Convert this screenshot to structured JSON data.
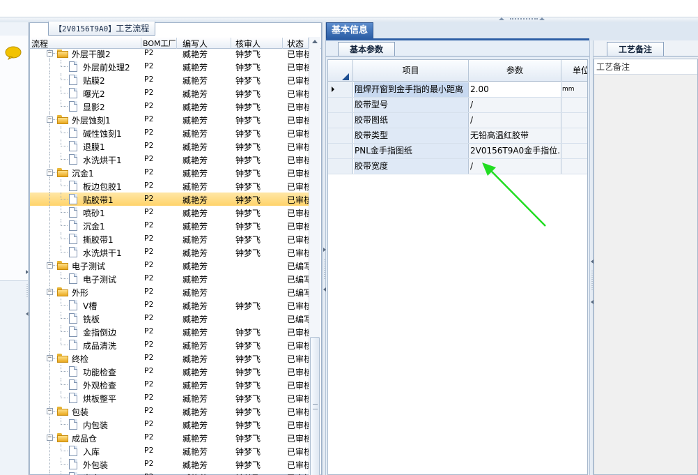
{
  "tree_panel": {
    "title_code": "【2V0156T9A0】",
    "title_text": "工艺流程",
    "columns": {
      "process": "流程",
      "bom_factory": "BOM工厂",
      "writer": "编写人",
      "reviewer": "核审人",
      "status": "状态"
    },
    "rows": [
      {
        "level": 1,
        "type": "folder",
        "name": "外层干膜2",
        "bom": "P2",
        "writer": "臧艳芳",
        "reviewer": "钟梦飞",
        "status": "已审核",
        "expanded": true
      },
      {
        "level": 2,
        "type": "doc",
        "name": "外层前处理2",
        "bom": "P2",
        "writer": "臧艳芳",
        "reviewer": "钟梦飞",
        "status": "已审核"
      },
      {
        "level": 2,
        "type": "doc",
        "name": "贴膜2",
        "bom": "P2",
        "writer": "臧艳芳",
        "reviewer": "钟梦飞",
        "status": "已审核"
      },
      {
        "level": 2,
        "type": "doc",
        "name": "曝光2",
        "bom": "P2",
        "writer": "臧艳芳",
        "reviewer": "钟梦飞",
        "status": "已审核"
      },
      {
        "level": 2,
        "type": "doc",
        "name": "显影2",
        "bom": "P2",
        "writer": "臧艳芳",
        "reviewer": "钟梦飞",
        "status": "已审核"
      },
      {
        "level": 1,
        "type": "folder",
        "name": "外层蚀刻1",
        "bom": "P2",
        "writer": "臧艳芳",
        "reviewer": "钟梦飞",
        "status": "已审核",
        "expanded": true
      },
      {
        "level": 2,
        "type": "doc",
        "name": "碱性蚀刻1",
        "bom": "P2",
        "writer": "臧艳芳",
        "reviewer": "钟梦飞",
        "status": "已审核"
      },
      {
        "level": 2,
        "type": "doc",
        "name": "退膜1",
        "bom": "P2",
        "writer": "臧艳芳",
        "reviewer": "钟梦飞",
        "status": "已审核"
      },
      {
        "level": 2,
        "type": "doc",
        "name": "水洗烘干1",
        "bom": "P2",
        "writer": "臧艳芳",
        "reviewer": "钟梦飞",
        "status": "已审核"
      },
      {
        "level": 1,
        "type": "folder",
        "name": "沉金1",
        "bom": "P2",
        "writer": "臧艳芳",
        "reviewer": "钟梦飞",
        "status": "已审核",
        "expanded": true
      },
      {
        "level": 2,
        "type": "doc",
        "name": "板边包胶1",
        "bom": "P2",
        "writer": "臧艳芳",
        "reviewer": "钟梦飞",
        "status": "已审核"
      },
      {
        "level": 2,
        "type": "doc",
        "name": "贴胶带1",
        "bom": "P2",
        "writer": "臧艳芳",
        "reviewer": "钟梦飞",
        "status": "已审核",
        "selected": true
      },
      {
        "level": 2,
        "type": "doc",
        "name": "喷砂1",
        "bom": "P2",
        "writer": "臧艳芳",
        "reviewer": "钟梦飞",
        "status": "已审核"
      },
      {
        "level": 2,
        "type": "doc",
        "name": "沉金1",
        "bom": "P2",
        "writer": "臧艳芳",
        "reviewer": "钟梦飞",
        "status": "已审核"
      },
      {
        "level": 2,
        "type": "doc",
        "name": "撕胶带1",
        "bom": "P2",
        "writer": "臧艳芳",
        "reviewer": "钟梦飞",
        "status": "已审核"
      },
      {
        "level": 2,
        "type": "doc",
        "name": "水洗烘干1",
        "bom": "P2",
        "writer": "臧艳芳",
        "reviewer": "钟梦飞",
        "status": "已审核"
      },
      {
        "level": 1,
        "type": "folder",
        "name": "电子测试",
        "bom": "P2",
        "writer": "臧艳芳",
        "reviewer": "",
        "status": "已编写",
        "expanded": true
      },
      {
        "level": 2,
        "type": "doc",
        "name": "电子测试",
        "bom": "P2",
        "writer": "臧艳芳",
        "reviewer": "",
        "status": "已编写"
      },
      {
        "level": 1,
        "type": "folder",
        "name": "外形",
        "bom": "P2",
        "writer": "臧艳芳",
        "reviewer": "",
        "status": "已编写",
        "expanded": true
      },
      {
        "level": 2,
        "type": "doc",
        "name": "V槽",
        "bom": "P2",
        "writer": "臧艳芳",
        "reviewer": "钟梦飞",
        "status": "已审核"
      },
      {
        "level": 2,
        "type": "doc",
        "name": "铣板",
        "bom": "P2",
        "writer": "臧艳芳",
        "reviewer": "",
        "status": "已编写"
      },
      {
        "level": 2,
        "type": "doc",
        "name": "金指倒边",
        "bom": "P2",
        "writer": "臧艳芳",
        "reviewer": "钟梦飞",
        "status": "已审核"
      },
      {
        "level": 2,
        "type": "doc",
        "name": "成品清洗",
        "bom": "P2",
        "writer": "臧艳芳",
        "reviewer": "钟梦飞",
        "status": "已审核"
      },
      {
        "level": 1,
        "type": "folder",
        "name": "终检",
        "bom": "P2",
        "writer": "臧艳芳",
        "reviewer": "钟梦飞",
        "status": "已审核",
        "expanded": true
      },
      {
        "level": 2,
        "type": "doc",
        "name": "功能检查",
        "bom": "P2",
        "writer": "臧艳芳",
        "reviewer": "钟梦飞",
        "status": "已审核"
      },
      {
        "level": 2,
        "type": "doc",
        "name": "外观检查",
        "bom": "P2",
        "writer": "臧艳芳",
        "reviewer": "钟梦飞",
        "status": "已审核"
      },
      {
        "level": 2,
        "type": "doc",
        "name": "烘板整平",
        "bom": "P2",
        "writer": "臧艳芳",
        "reviewer": "钟梦飞",
        "status": "已审核"
      },
      {
        "level": 1,
        "type": "folder",
        "name": "包装",
        "bom": "P2",
        "writer": "臧艳芳",
        "reviewer": "钟梦飞",
        "status": "已审核",
        "expanded": true
      },
      {
        "level": 2,
        "type": "doc",
        "name": "内包装",
        "bom": "P2",
        "writer": "臧艳芳",
        "reviewer": "钟梦飞",
        "status": "已审核"
      },
      {
        "level": 1,
        "type": "folder",
        "name": "成品仓",
        "bom": "P2",
        "writer": "臧艳芳",
        "reviewer": "钟梦飞",
        "status": "已审核",
        "expanded": true
      },
      {
        "level": 2,
        "type": "doc",
        "name": "入库",
        "bom": "P2",
        "writer": "臧艳芳",
        "reviewer": "钟梦飞",
        "status": "已审核"
      },
      {
        "level": 2,
        "type": "doc",
        "name": "外包装",
        "bom": "P2",
        "writer": "臧艳芳",
        "reviewer": "钟梦飞",
        "status": "已审核"
      },
      {
        "level": 2,
        "type": "doc",
        "name": "出库",
        "bom": "P2",
        "writer": "臧艳芳",
        "reviewer": "钟梦飞",
        "status": "已审核"
      }
    ]
  },
  "main_panel": {
    "tab_label": "基本信息",
    "basic_tab_label": "基本参数",
    "grid_columns": {
      "item": "项目",
      "param": "参数",
      "unit": "单位"
    },
    "grid_rows": [
      {
        "item": "阻焊开窗到金手指的最小距离",
        "param": "2.00",
        "unit": "mm",
        "current": true
      },
      {
        "item": "胶带型号",
        "param": "/",
        "unit": ""
      },
      {
        "item": "胶带图纸",
        "param": "/",
        "unit": ""
      },
      {
        "item": "胶带类型",
        "param": "无铅高温红胶带",
        "unit": ""
      },
      {
        "item": "PNL金手指图纸",
        "param": "2V0156T9A0金手指位...",
        "unit": ""
      },
      {
        "item": "胶带宽度",
        "param": "/",
        "unit": ""
      }
    ]
  },
  "notes_panel": {
    "tab_label": "工艺备注",
    "header": "工艺备注"
  },
  "colors": {
    "accent_blue": "#2c5fa6",
    "selection_yellow": "#ffd36a",
    "annotation_arrow": "#22dd22"
  }
}
